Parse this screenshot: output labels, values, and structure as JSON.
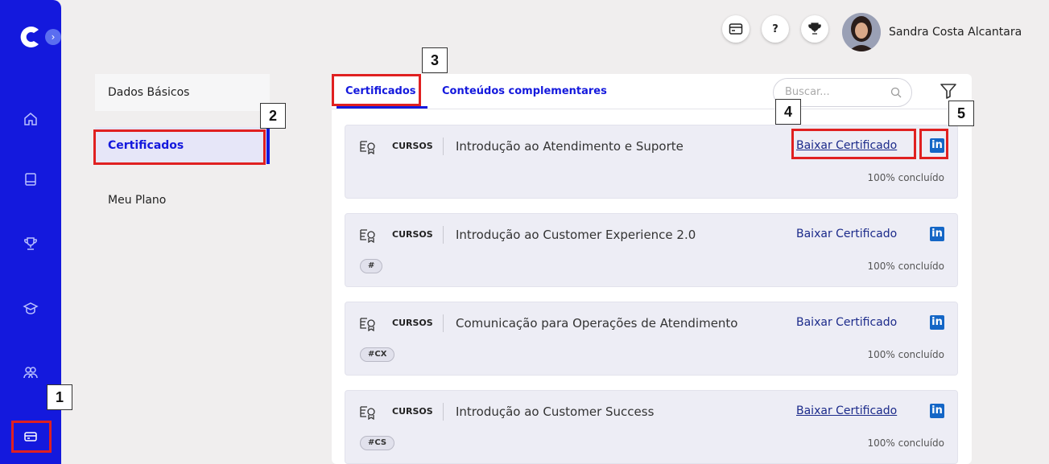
{
  "header": {
    "user_name": "Sandra Costa Alcantara",
    "help_label": "?",
    "icons": [
      "card-icon",
      "help-icon",
      "trophy-icon",
      "avatar"
    ]
  },
  "rail": {
    "collapse_glyph": "›",
    "icons": [
      "home-icon",
      "book-icon",
      "trophy-icon",
      "graduation-cap-icon",
      "users-icon",
      "credit-card-icon"
    ]
  },
  "submenu": {
    "items": [
      {
        "label": "Dados Básicos"
      },
      {
        "label": "Certificados"
      },
      {
        "label": "Meu Plano"
      }
    ]
  },
  "tabs": [
    {
      "label": "Certificados"
    },
    {
      "label": "Conteúdos complementares"
    }
  ],
  "search": {
    "placeholder": "Buscar..."
  },
  "certificates": [
    {
      "type": "CURSOS",
      "title": "Introdução ao Atendimento e Suporte",
      "download_label": "Baixar Certificado",
      "linkedin": "in",
      "tag": "",
      "progress": "100% concluído"
    },
    {
      "type": "CURSOS",
      "title": "Introdução ao Customer Experience 2.0",
      "download_label": "Baixar Certificado",
      "linkedin": "in",
      "tag": "#",
      "progress": "100% concluído"
    },
    {
      "type": "CURSOS",
      "title": "Comunicação para Operações de Atendimento",
      "download_label": "Baixar Certificado",
      "linkedin": "in",
      "tag": "#CX",
      "progress": "100% concluído"
    },
    {
      "type": "CURSOS",
      "title": "Introdução ao Customer Success",
      "download_label": "Baixar Certificado",
      "linkedin": "in",
      "tag": "#CS",
      "progress": "100% concluído"
    }
  ],
  "callouts": [
    "1",
    "2",
    "3",
    "4",
    "5"
  ],
  "colors": {
    "brand": "#1419dd",
    "annotation": "#e02020",
    "linkedin": "#1466c6"
  }
}
